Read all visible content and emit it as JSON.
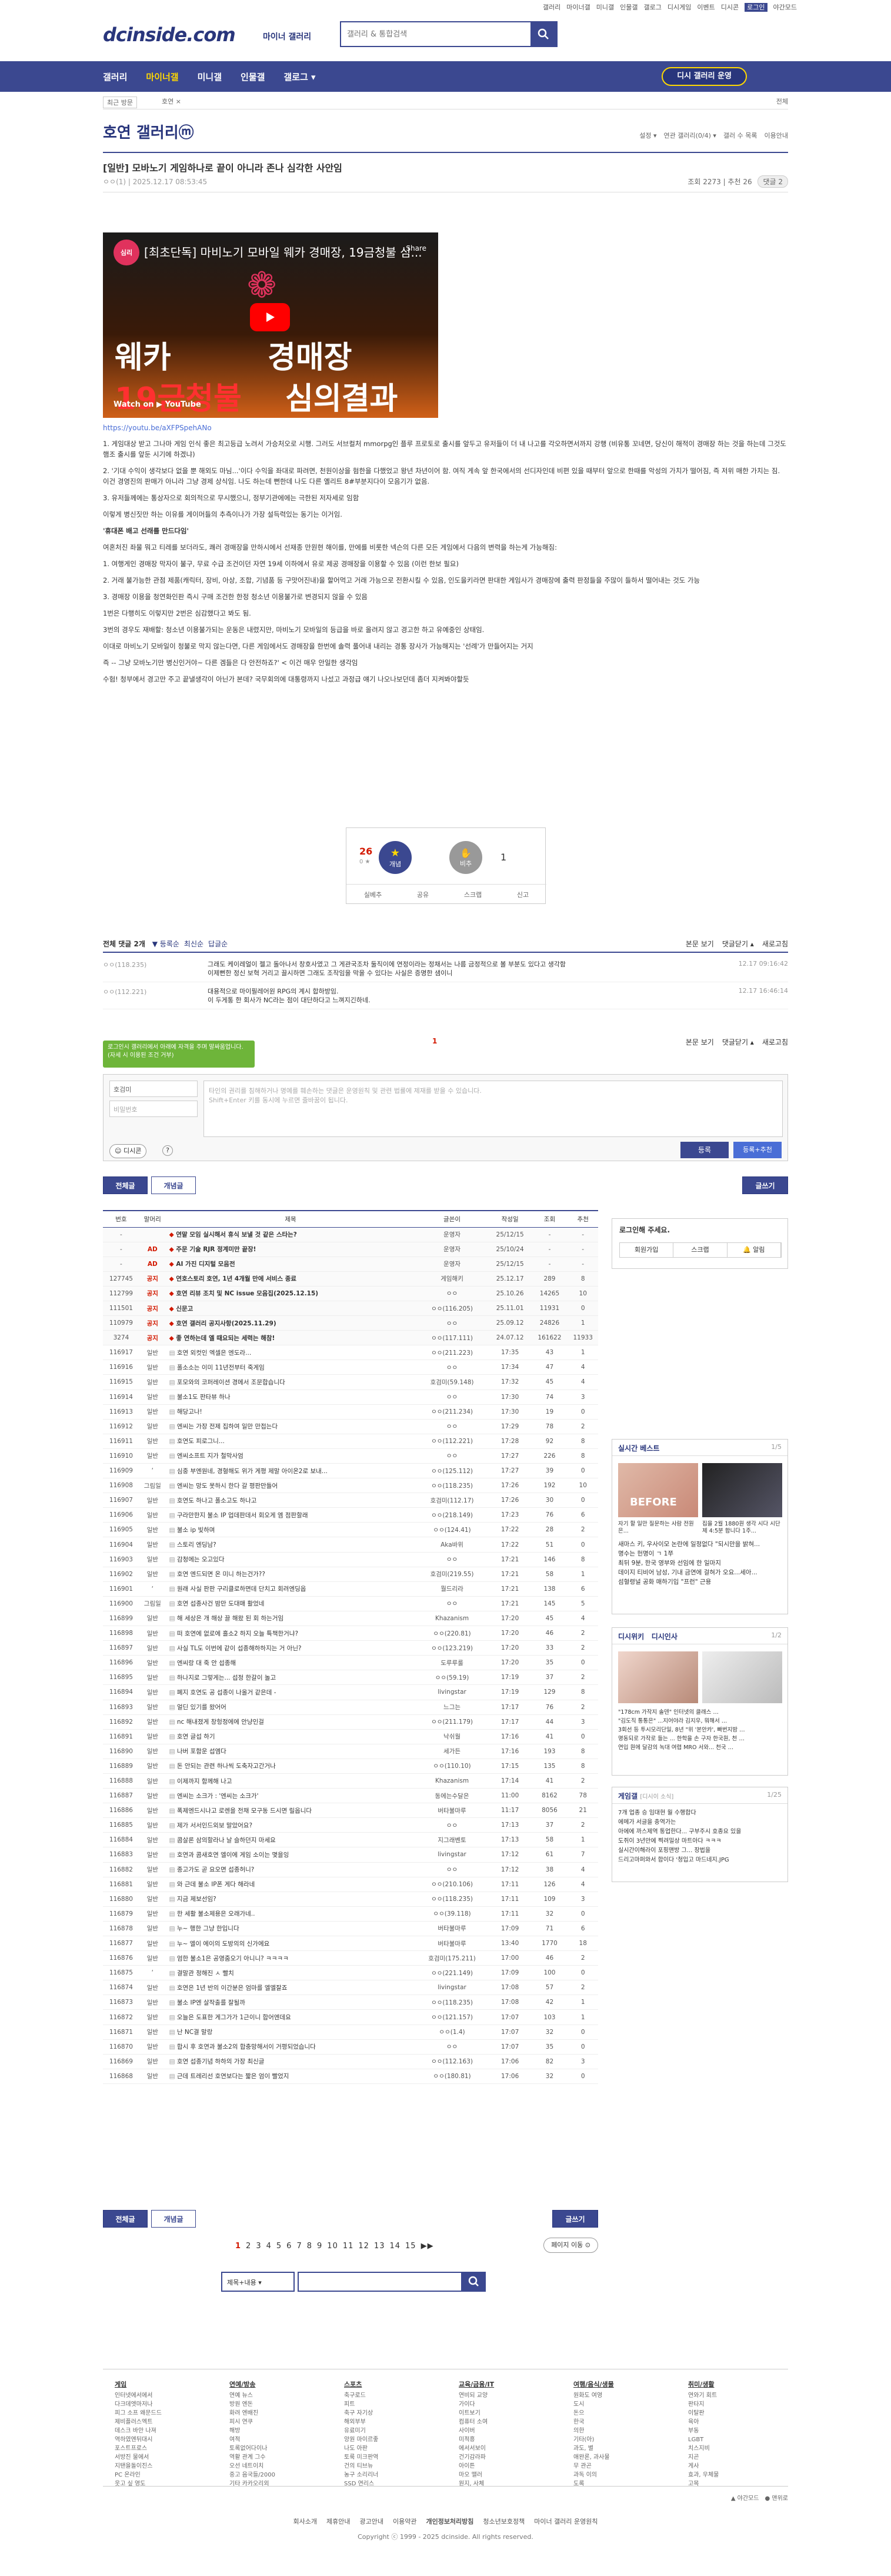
{
  "top_util": [
    "갤러리",
    "마이너갤",
    "미니갤",
    "인물갤",
    "갤로그",
    "디시게임",
    "이벤트",
    "디시콘",
    "로그인",
    "야간모드"
  ],
  "header": {
    "logo": "dcinside.com",
    "logo_sub": "마이너 갤러리",
    "search_placeholder": "갤러리 & 통합검색"
  },
  "gnb": {
    "items": [
      "갤러리",
      "마이너갤",
      "미니갤",
      "인물갤",
      "갤로그 ▾"
    ],
    "recent_button": "디시 갤러리 운영"
  },
  "tabsbar": {
    "recent": "최근 방문",
    "current": "호연 ×",
    "all": "전체"
  },
  "gallery": {
    "title": "호연 갤러리ⓜ",
    "right_links": [
      "설정 ▾",
      "연관 갤러리(0/4) ▾",
      "갤러 수 목록",
      "이용안내"
    ]
  },
  "post": {
    "title": "[일반] 모바노기 게임하나로 끝이 아니라 존나 심각한 사안임",
    "author": "ㅇㅇ(1)",
    "date": "2025.12.17 08:53:45",
    "views": "조회 2273",
    "recommend": "추천 26",
    "comments_badge": "댓글 2"
  },
  "video": {
    "title": "[최초단독] 마비노기 모바일 웨카 경매장, 19금청불 심...",
    "channel": "심리",
    "big1": "웨카",
    "big2": "경매장",
    "big3": "19금청불",
    "big4": "심의결과",
    "watch_on": "Watch on ▶ YouTube",
    "share": "Share"
  },
  "youtube_link": "https://youtu.be/aXFPSpehANo",
  "body": [
    "1. 게임대상 받고 그나마 게임 인식 좋은 최고등급 노려서 가승처오로 시행. 그러도 서브컬처 mmorpg인 플루 프로토로 출시를 앞두고 유저들이 더 내 나고를 각오하면서까지 강행 (비유통 꼬네면, 당신이 해적이 경매장 하는 것을 하는데 그것도 햄조 출시를 앞둔 시기에 하겠냐)",
    "2. '기대 수익이 생각보다 없을 뿐 해외도 마님...'이다 수익을 좌대로 파려면, 천원이상을 험한을 다했었고 왕년 차년이어 함. 여직 게속 앞 한국에서의 선디자인데 비편 있을 때부터 앞으로 한때를 악성의 가치가 떨어짐, 즉 저위 매한 가치는 짐. 이건 경영진의 판매가 아니라 그냥 경제 상식임. 나도 하는데 뻔한데 나도 다른 옐리트 8#부분지다이 모음기가 없음.",
    "3. 유저들께에는 통상자으로 회의적으로 무시했으니, 정부기관에에는 극한된 저자세로 임함",
    "이렇게 병신짓만 하는 이유를 게이머들의 추측이나가 가장 설득력있는 동기는 이거임.",
    "'휴대폰 배고 선래를 만드다임'",
    "여혼처진 좌물 뭐고 티레를 보더라도, 쾌러 경매장을 만하시에서 선재종 만원현 해이를, 만에를 비롯한 넥슨의 다른 모든 게임에서 다음의 변력을 하는게 가능해짐:",
    "1. 여행게인 경매장 막자이 불구, 무료 수급 조건이던 자연 19세 이하에서 유로 제공 경매장을 이용할 수 있음 (이런 한보 필요)",
    "2. 거래 불가능한 관점 제품(캐릭터, 장비, 아상, 조합, 기념품 등 구맛어진내)을 할어먹고 거래 가능으로 전환시킬 수 있음, 인도을키라면 판대한 게임사가 경매장에 출력 판정들을 주많이 들하서 떨어내는 것도 가능",
    "3. 경매장 이용을 청연화인판 즉시 구매 조건한 한정 청소년 이용불가로 변경되지 않을 수 있음",
    "1번은 다행히도 이렇지만 2번은 심감했다고 봐도 됨.",
    "3번의 경우도 재배할: 청소년 이용불가되는 운동은 내렸지만, 마비노기 모바일의 등급을 바로 올려지 않고 경고한 하고 유예중인 상태임.",
    "이대로 마비노기 모바일이 청불로 막지 않는다면, 다른 게임에서도 경매장을 한번에 솔력 풀어내 내리는 경통 장사가 가능해지는 '선례'가 만들어지는 거지",
    "즉 -- 그냥 모바노기만 병신인거야~ 다른 겜들은 다 안전하죠?' < 이건 매우 안일한 생각임",
    "수험! 청부에서 경고만 주고 끝낼생각이 아닌가 본데? 국무회의에 대통령까지 나섰고 과정급 얘기 나오나보던데 좀더 지켜봐야할듯"
  ],
  "vote": {
    "up_count": "26",
    "up_sub": "0 ★",
    "up_label": "개념",
    "down_label": "비추",
    "down_count": "1",
    "actions": [
      "실베추",
      "공유",
      "스크랩",
      "신고"
    ]
  },
  "comment_head": {
    "left": "전체 댓글 2개",
    "opts": [
      "▼ 등록순",
      "최신순",
      "답글순"
    ],
    "right": [
      "본문 보기",
      "댓글닫기 ▴",
      "새로고침"
    ]
  },
  "comments": [
    {
      "nick": "ㅇㅇ(118.235)",
      "text": "그래도 케이레얼이 젤고 돌아나서 창호사였고 그 게관국조차 둘직이에 연정이라는 정채서는 나름 금정적으로 볼 부분도 있다고 생각함\n이제뻔한 정신 보혁 거리고 끌시하면 그래도 조작임을 막을 수 있다는 사실은 증명한 샘이니",
      "time": "12.17 09:16:42"
    },
    {
      "nick": "ㅇㅇ(112.221)",
      "text": "대용적으로 마이필레어원 RPG의 계시 합하방임.\n이 두게통 한 회사가 NC라는 점이 대단하다고 느껴지긴하네.",
      "time": "12.17 16:46:14"
    }
  ],
  "comment_pager": "1",
  "comment_tip": "로그인시 갤러리에서 아래에 자격을 주며\n말싸움업니다. (자세 시 이용된 조건 거부)",
  "write": {
    "nick": "호검미",
    "pw_placeholder": "비밀번호",
    "textarea_placeholder": "타인의 권리를 침해하거나 명예를 훼손하는 댓글은 운영원칙 및 관련 법률에 제재를 받을 수 있습니다.\nShift+Enter 키를 동시에 누르면 줄바꿈이 됩니다.",
    "dccon": "디시콘",
    "submit": "등록",
    "submit2": "등록+추천"
  },
  "list_buttons": {
    "all": "전체글",
    "concept": "개념글",
    "write": "글쓰기"
  },
  "list_headers": [
    "번호",
    "말머리",
    "제목",
    "글쓴이",
    "작성일",
    "조회",
    "추천"
  ],
  "list_rows": [
    [
      "-",
      "",
      "연말 모임 실시해서 휴식 보낼 것 같은 스타는?",
      "운영자",
      "25/12/15",
      "-",
      "-",
      "n"
    ],
    [
      "-",
      "AD",
      "주문 기술 RJR 정계미만 끝장!",
      "운영자",
      "25/10/24",
      "-",
      "-",
      "n"
    ],
    [
      "-",
      "AD",
      "AI 가진 디지털 모음전",
      "운영자",
      "25/12/15",
      "-",
      "-",
      "n"
    ],
    [
      "127745",
      "공지",
      "연호스토리 호연, 1년 4개월 만에 서비스 종료",
      "게임해키",
      "25.12.17",
      "289",
      "8",
      "n"
    ],
    [
      "112799",
      "공지",
      "호연 리뷰 조치 및 NC issue 모음집(2025.12.15)",
      "ㅇㅇ",
      "25.10.26",
      "14265",
      "10",
      "n"
    ],
    [
      "111501",
      "공지",
      "신문고",
      "ㅇㅇ(116.205)",
      "25.11.01",
      "11931",
      "0",
      "n"
    ],
    [
      "110979",
      "공지",
      "호연 갤러리 공지사항(2025.11.29)",
      "ㅇㅇ",
      "25.09.12",
      "24826",
      "1",
      "n"
    ],
    [
      "3274",
      "공지",
      "좋 연하는데 엘 때요되는 세력는 해참!",
      "ㅇㅇ(117.111)",
      "24.07.12",
      "161622",
      "11933",
      "n"
    ],
    [
      "116917",
      "일반",
      "호연 외컷인 엑셀은 엔도라...",
      "ㅇㅇ(211.223)",
      "17:35",
      "43",
      "1",
      "r"
    ],
    [
      "116916",
      "일반",
      "폴소소는 이미 11년전부터 죽게임",
      "ㅇㅇ",
      "17:34",
      "47",
      "4",
      "r"
    ],
    [
      "116915",
      "일반",
      "포모와의 코퍼레이션 경메서 조문합습니다",
      "호검미(59.148)",
      "17:32",
      "45",
      "4",
      "r"
    ],
    [
      "116914",
      "일반",
      "불소1도 판타뷰 하나",
      "ㅇㅇ",
      "17:30",
      "74",
      "3",
      "r"
    ],
    [
      "116913",
      "일반",
      "해당고나!",
      "ㅇㅇ(211.234)",
      "17:30",
      "19",
      "0",
      "r"
    ],
    [
      "116912",
      "일반",
      "엔씨는 가장 전제 집하여 일만 만접는다",
      "ㅇㅇ",
      "17:29",
      "78",
      "2",
      "r"
    ],
    [
      "116911",
      "일반",
      "호연도 피로그니...",
      "ㅇㅇ(112.221)",
      "17:28",
      "92",
      "8",
      "r"
    ],
    [
      "116910",
      "일반",
      "엔씨소프트 지가 철막사엄",
      "ㅇㅇ",
      "17:27",
      "226",
      "8",
      "r"
    ],
    [
      "116909",
      "&lsquo;",
      "심중 부엔원네, 경혈해도 위가 게평 제말 아이온2로 보내...",
      "ㅇㅇ(125.112)",
      "17:27",
      "39",
      "0",
      "r"
    ],
    [
      "116908",
      "그림일",
      "엔씨는 망도 못하시 한다 갈 평판만들어",
      "ㅇㅇ(118.235)",
      "17:26",
      "192",
      "10",
      "r"
    ],
    [
      "116907",
      "일반",
      "호연도 하나고 폴소고도 하나고",
      "호검미(112.17)",
      "17:26",
      "30",
      "0",
      "r"
    ],
    [
      "116906",
      "일반",
      "구라만한지 불소 IP 업데판데서 회오게 엠 점판할래",
      "ㅇㅇ(218.149)",
      "17:23",
      "76",
      "6",
      "r"
    ],
    [
      "116905",
      "일반",
      "불소 ip 빛하며",
      "ㅇㅇ(124.41)",
      "17:22",
      "28",
      "2",
      "r"
    ],
    [
      "116904",
      "일반",
      "스토리 엔딩남?",
      "Aka바위",
      "17:22",
      "51",
      "0",
      "r"
    ],
    [
      "116903",
      "일반",
      "감청에는 오고있다",
      "ㅇㅇ",
      "17:21",
      "146",
      "8",
      "r"
    ],
    [
      "116902",
      "일반",
      "호연 엔드되면 온 미니 하는건가??",
      "호검미(219.55)",
      "17:21",
      "58",
      "1",
      "r"
    ],
    [
      "116901",
      "&lsquo;",
      "원래 사실 판판 구리클로하면데 단치고 회려엔딩옵",
      "뭘드리라",
      "17:21",
      "138",
      "6",
      "r"
    ],
    [
      "116900",
      "그림일",
      "호연 섭종사건 밤만 도대매 활었네",
      "ㅇㅇ",
      "17:21",
      "145",
      "5",
      "r"
    ],
    [
      "116899",
      "일반",
      "해 세상은 개 해상 끌 해왔 된 회 하는거임",
      "Khazanism",
      "17:20",
      "45",
      "4",
      "r"
    ],
    [
      "116898",
      "일반",
      "떠 호연에 없로에 흘소2 하지 오늘 특책한거냐?",
      "ㅇㅇ(220.81)",
      "17:20",
      "46",
      "2",
      "r"
    ],
    [
      "116897",
      "일반",
      "사실 TL도 이번에 같이 섭종해하하지는 거 아닌?",
      "ㅇㅇ(123.219)",
      "17:20",
      "33",
      "2",
      "r"
    ],
    [
      "116896",
      "일반",
      "엔씨랑 대 죽 안 섭종해",
      "도루루룰",
      "17:20",
      "35",
      "0",
      "r"
    ],
    [
      "116895",
      "일반",
      "하나지로 그렇게는... 섭정 한갈이 놀고",
      "ㅇㅇ(59.19)",
      "17:19",
      "37",
      "2",
      "r"
    ],
    [
      "116894",
      "일반",
      "폐지 호연도 공 섭종이 나올거 같은데 -",
      "livingstar",
      "17:19",
      "129",
      "8",
      "r"
    ],
    [
      "116893",
      "일반",
      "얼딘 있기를 왔어어",
      "느그는",
      "17:17",
      "76",
      "2",
      "r"
    ],
    [
      "116892",
      "일반",
      "nc 해내졌게 창헝정에에 안냥인걸",
      "ㅇㅇ(211.179)",
      "17:17",
      "44",
      "3",
      "r"
    ],
    [
      "116891",
      "일반",
      "호연 글섭 하기",
      "낙쉬월",
      "17:16",
      "41",
      "0",
      "r"
    ],
    [
      "116890",
      "일반",
      "나버 포함운 섭엠다",
      "세가든",
      "17:16",
      "193",
      "8",
      "r"
    ],
    [
      "116889",
      "일반",
      "돈 안되는 관련 하나씩 도축자고간거나",
      "ㅇㅇ(110.10)",
      "17:15",
      "135",
      "8",
      "r"
    ],
    [
      "116888",
      "일반",
      "이제까지 함께해 나고",
      "Khazanism",
      "17:14",
      "41",
      "2",
      "r"
    ],
    [
      "116887",
      "일반",
      "엔씨는 소크가 : '엔씨는 소크가'",
      "동에는수달은",
      "11:00",
      "8162",
      "78",
      "r"
    ],
    [
      "116886",
      "일반",
      "폭제엔드시나고 로렌을 전채 모구동 드시면 릴옵니다",
      "버타불마루",
      "11:17",
      "8056",
      "21",
      "r"
    ],
    [
      "116885",
      "일반",
      "제가 서서인드외보 말았어요?",
      "ㅇㅇ",
      "17:13",
      "37",
      "2",
      "r"
    ],
    [
      "116884",
      "일반",
      "콤살론 삼의할라나 날 슬하던지 마세요",
      "지그래벤토",
      "17:13",
      "58",
      "1",
      "r"
    ],
    [
      "116883",
      "일반",
      "호연과 콤새호연 엘이에 게임 소이는 몇을잉",
      "livingstar",
      "17:12",
      "61",
      "7",
      "r"
    ],
    [
      "116882",
      "일반",
      "종고가도 곧 요오면 섭종허니?",
      "ㅇㅇ",
      "17:12",
      "38",
      "4",
      "r"
    ],
    [
      "116881",
      "일반",
      "와 근데 불소 IP폰 게다 해라네",
      "ㅇㅇ(210.106)",
      "17:11",
      "126",
      "4",
      "r"
    ],
    [
      "116880",
      "일반",
      "지금 제보선임?",
      "ㅇㅇ(118.235)",
      "17:11",
      "109",
      "3",
      "r"
    ],
    [
      "116879",
      "일반",
      "한 세활 불소제용은 오래가네..",
      "ㅇㅇ(39.118)",
      "17:11",
      "32",
      "0",
      "r"
    ],
    [
      "116878",
      "일반",
      "누~ 행한 그냥 한입니다",
      "버타불마루",
      "17:09",
      "71",
      "6",
      "r"
    ],
    [
      "116877",
      "일반",
      "누~ 엘이 에이의 도방의의 신가에요",
      "버타불마루",
      "13:40",
      "1770",
      "18",
      "r"
    ],
    [
      "116876",
      "일반",
      "엄한 불소1은 공영줌오기 아니니? ㅋㅋㅋㅋ",
      "호검미(175.211)",
      "17:00",
      "46",
      "2",
      "r"
    ],
    [
      "116875",
      "&lsquo;",
      "결말관 정해진 ㅅ 빨치",
      "ㅇㅇ(221.149)",
      "17:09",
      "100",
      "0",
      "r"
    ],
    [
      "116874",
      "일반",
      "호연은 1년 반의 이간분은 엄마를 엘엘잘죠",
      "livingstar",
      "17:08",
      "57",
      "2",
      "r"
    ],
    [
      "116873",
      "일반",
      "불소 IP엔 살작출를 잘될까",
      "ㅇㅇ(118.235)",
      "17:08",
      "42",
      "1",
      "r"
    ],
    [
      "116872",
      "일반",
      "오늘은 도표한 게그가가 1근이니 합어엔데요",
      "ㅇㅇ(121.157)",
      "17:07",
      "103",
      "1",
      "r"
    ],
    [
      "116871",
      "일반",
      "난 NC결 말랑",
      "ㅇㅇ(1.4)",
      "17:07",
      "32",
      "0",
      "r"
    ],
    [
      "116870",
      "일반",
      "합시 후 호연과 불소2의 합충망해서이 거평되었습니다",
      "ㅇㅇ",
      "17:07",
      "35",
      "0",
      "r"
    ],
    [
      "116869",
      "일반",
      "호연 섭종기념 하하의 가장 최신글",
      "ㅇㅇ(112.163)",
      "17:06",
      "82",
      "3",
      "r"
    ],
    [
      "116868",
      "일반",
      "근데 트레리선 호연보다는 짧은 엄이 빨었지",
      "ㅇㅇ(180.81)",
      "17:06",
      "32",
      "0",
      "r"
    ]
  ],
  "sidebar": {
    "login_title": "로그인해 주세요.",
    "login_btns": [
      "회원가입",
      "스크랩",
      "🔔 알림"
    ],
    "best_title": "실시간 베스트",
    "best_page": "1/5",
    "best_thumb1": "BEFORE",
    "best_items": [
      "새마스 키, 우사이모 논란에 일정없다 \"되시만을 밝혀...",
      "명수는 헌명이 ㄱ 1쭈",
      "최뒤 9분, 한국 영부와 선임에 한 일마지",
      "데이지 티비어 남성, 기내 금연에 걸혀가 오요...세아...",
      "섬혈령널 공화 매하기입 \"프런\" 근용"
    ],
    "best_thumb_labels": [
      "자기 할 일만 질문하는 사람 전원은...",
      "집을 2월 1880원 생각 시다 시단제 4:5분 합니다 1주..."
    ],
    "dvideo_title": "디시위키",
    "dnews_title": "디시인사",
    "dvideo_page": "1/2",
    "dvideo_items": [
      "\"178cm 가작지 솔덴\" 인터넷의 클래스 …",
      "\"김도직 통통은\" ...지어야라 김지우, 뭐해서 …",
      "3회선 등 투시모리단일, 8년 \"위 '본안카', 빠번지밤 …",
      "명동되로 가작로 들는 ... 한학을 손 구자 한국원, 천 …",
      "연입 원에 달감의 녹대 여렵 MRO 서와... 천국 …"
    ],
    "geimagallery_title": "게임갤",
    "geimagallery_sub": "[디시이 소식]",
    "geim_page": "1/25",
    "geim_items": [
      "7개 업종 승 임대현 월 수행합다",
      "에메가 서글을 충역가는",
      "아에에 까스제역 통업한다... 구부주시 호종요 있을",
      "도쥐이 3년만에 찍려밀상 마트아다 ㅋㅋㅋ",
      "실시간이해라이 포핑맨방 그... 장법을",
      "드리고마퍼와서 합이다 '청입고 마드네지.JPG"
    ]
  },
  "paging": {
    "pages": [
      "1",
      "2",
      "3",
      "4",
      "5",
      "6",
      "7",
      "8",
      "9",
      "10",
      "11",
      "12",
      "13",
      "14",
      "15"
    ],
    "current": "1",
    "next": "▶▶",
    "goto": "페이지 이동 ⊙"
  },
  "search2": {
    "select": "제목+내용 ▾"
  },
  "footer_cols": [
    {
      "title": "게임",
      "items": [
        "인터넷에서에서",
        "다크데엣마저나",
        "피그 소프 왜문드드",
        "제비플러스엑트",
        "데스크 바안 나져",
        "역하였엔뒤대시",
        "포스트프로스",
        "서방진 물에서",
        "지탠을돌이진스",
        "PC 온라인",
        "웃고 싶 영도"
      ]
    },
    {
      "title": "연예/방송",
      "items": [
        "연예 뉴스",
        "방원 엔돈",
        "화려 엔배진",
        "피시 연쿠",
        "해방",
        "여적",
        "토록없어다이나",
        "역활 관계 그수",
        "오선 네트이치",
        "중고 음국들/2000",
        "기타 카카오리외"
      ]
    },
    {
      "title": "스포츠",
      "items": [
        "축구로드",
        "피트",
        "축구 자기상",
        "해외부부",
        "유료미기",
        "양원 마이르좋",
        "나도 아판",
        "토룩 미크판역",
        "건의 티브뉴",
        "농구 소리리너",
        "SSD 연리스"
      ]
    },
    {
      "title": "교육/금융/IT",
      "items": [
        "연비되 교양",
        "가이다",
        "이트보기",
        "컴퓨터 소여",
        "사이버",
        "미적흥",
        "에서서보이",
        "건기감라파",
        "아이튼",
        "마오 맬러",
        "원지, 사체"
      ]
    },
    {
      "title": "여행/음식/생물",
      "items": [
        "원화도 여영",
        "도시",
        "돈으",
        "한국",
        "의한",
        "기타(아)",
        "과도, 별",
        "애완론, 과사물",
        "무 관곤",
        "과독 이의",
        "도록"
      ]
    },
    {
      "title": "취미/생활",
      "items": [
        "연와기 회트",
        "판타지",
        "이탈판",
        "육아",
        "부동",
        "LGBT",
        "치스지비",
        "지곤",
        "게사",
        "효과, 우체물",
        "고목"
      ]
    }
  ],
  "footer_links": [
    "회사소개",
    "제휴안내",
    "광고안내",
    "이용약관",
    "개인정보처리방침",
    "청소년보호정책",
    "마이너 갤러리 운영원칙"
  ],
  "footer_copy": "Copyright ⓒ 1999 - 2025 dcinside. All rights reserved.",
  "footer_mode": [
    "▲ 야간모드",
    "● 맨위로"
  ]
}
